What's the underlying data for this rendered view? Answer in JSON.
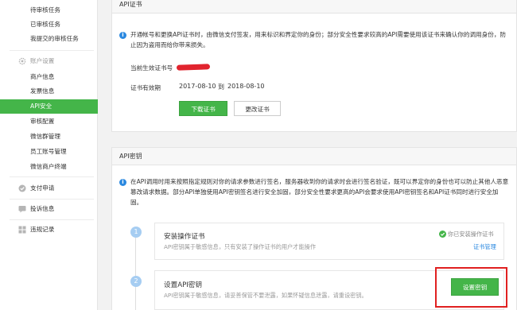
{
  "sidebar": {
    "top_items": [
      "待审核任务",
      "已审核任务",
      "我提交的审核任务"
    ],
    "account_group": "账户设置",
    "account_items": [
      "商户信息",
      "发票信息",
      "API安全",
      "审核配置",
      "微信群管理",
      "员工账号管理",
      "微信商户终端"
    ],
    "active_item": "API安全",
    "other_groups": [
      "支付申请",
      "投诉信息",
      "违规记录"
    ]
  },
  "api_cert": {
    "header": "API证书",
    "notice": "开通帐号和更换API证书时，由微信支付签发，用来标识和界定你的身份；部分安全性要求较高的API需要使用该证书来确认你的调用身份，防止因为盗用而给你带来损失。",
    "current_cert_label": "当前生效证书号",
    "validity_label": "证书有效期",
    "validity_start": "2017-08-10",
    "validity_to": "到",
    "validity_end": "2018-08-10",
    "download_button": "下载证书",
    "change_button": "更改证书"
  },
  "api_key": {
    "header": "API密钥",
    "notice": "在API调用时用来按照指定规则对你的请求参数进行签名，服务器收到你的请求时会进行签名验证，既可以界定你的身份也可以防止其他人恶意篡改请求数据。部分API单独使用API密钥签名进行安全加固，部分安全性要求更高的API会要求使用API密钥签名和API证书同时进行安全加固。",
    "steps": [
      {
        "number": "1",
        "title": "安装操作证书",
        "desc": "API密钥属于敏感信息，只有安装了操作证书的用户才能操作",
        "status": "你已安装操作证书",
        "link": "证书管理"
      },
      {
        "number": "2",
        "title": "设置API密钥",
        "desc": "API密钥属于敏感信息，请妥善保管不要泄露，如果怀疑信息泄露，请重设密钥。",
        "button": "设置密钥"
      }
    ]
  },
  "colors": {
    "brand_green": "#44b549",
    "info_blue": "#2b89e0",
    "highlight_red": "#e02020"
  }
}
